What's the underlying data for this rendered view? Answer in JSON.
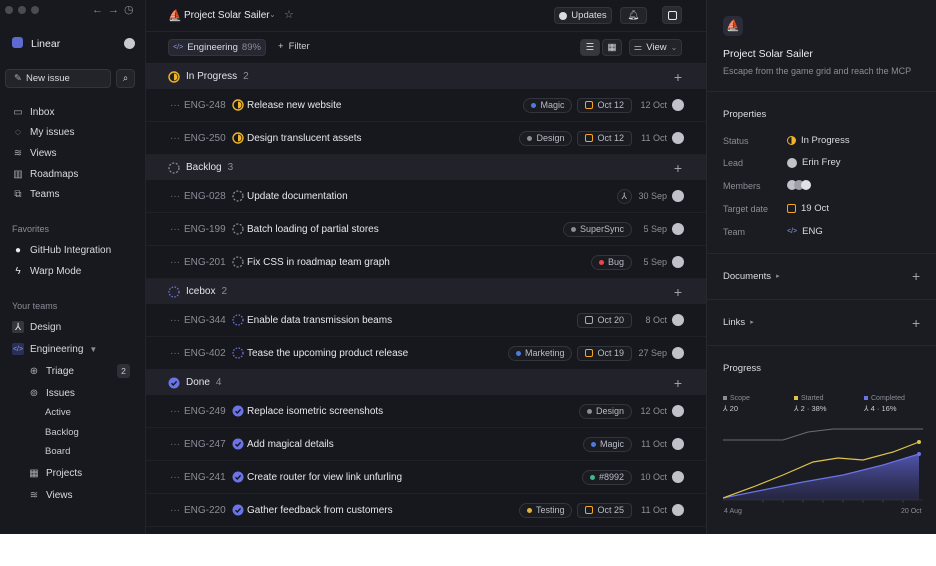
{
  "sidebar": {
    "workspace": "Linear",
    "new_issue": "New issue",
    "nav": [
      "Inbox",
      "My issues",
      "Views",
      "Roadmaps",
      "Teams"
    ],
    "favorites_label": "Favorites",
    "favorites": [
      "GitHub Integration",
      "Warp Mode"
    ],
    "your_teams_label": "Your teams",
    "teams": {
      "design": "Design",
      "engineering": "Engineering"
    },
    "triage": "Triage",
    "triage_count": "2",
    "issues": "Issues",
    "issue_views": [
      "Active",
      "Backlog",
      "Board"
    ],
    "projects": "Projects",
    "views": "Views"
  },
  "header": {
    "project": "Project Solar Sailer",
    "updates": "Updates",
    "team_filter": "Engineering",
    "team_pct": "89%",
    "filter": "Filter",
    "view": "View"
  },
  "groups": [
    {
      "name": "In Progress",
      "count": "2",
      "issues": [
        {
          "id": "ENG-248",
          "title": "Release new website",
          "label": "Magic",
          "label_color": "#4f7bdc",
          "due": "Oct 12",
          "date": "12 Oct"
        },
        {
          "id": "ENG-250",
          "title": "Design translucent assets",
          "label": "Design",
          "label_color": "#8a8d97",
          "due": "Oct 12",
          "date": "11 Oct"
        }
      ]
    },
    {
      "name": "Backlog",
      "count": "3",
      "issues": [
        {
          "id": "ENG-028",
          "title": "Update documentation",
          "label": "",
          "label_color": "",
          "due": "",
          "date": "30 Sep"
        },
        {
          "id": "ENG-199",
          "title": "Batch loading of partial stores",
          "label": "SuperSync",
          "label_color": "#8a8d97",
          "due": "",
          "date": "5 Sep"
        },
        {
          "id": "ENG-201",
          "title": "Fix CSS in roadmap team graph",
          "label": "Bug",
          "label_color": "#e5484d",
          "due": "",
          "date": "5 Sep"
        }
      ]
    },
    {
      "name": "Icebox",
      "count": "2",
      "issues": [
        {
          "id": "ENG-344",
          "title": "Enable data transmission beams",
          "label": "",
          "label_color": "",
          "due": "Oct 20",
          "date": "8 Oct"
        },
        {
          "id": "ENG-402",
          "title": "Tease the upcoming product release",
          "label": "Marketing",
          "label_color": "#4f7bdc",
          "due": "Oct 19",
          "date": "27 Sep"
        }
      ]
    },
    {
      "name": "Done",
      "count": "4",
      "issues": [
        {
          "id": "ENG-249",
          "title": "Replace isometric screenshots",
          "label": "Design",
          "label_color": "#8a8d97",
          "due": "",
          "date": "12 Oct"
        },
        {
          "id": "ENG-247",
          "title": "Add magical details",
          "label": "Magic",
          "label_color": "#4f7bdc",
          "due": "",
          "date": "11 Oct"
        },
        {
          "id": "ENG-241",
          "title": "Create router for view link unfurling",
          "label": "#8992",
          "label_color": "#3fb68b",
          "due": "",
          "date": "10 Oct"
        },
        {
          "id": "ENG-220",
          "title": "Gather feedback from customers",
          "label": "Testing",
          "label_color": "#e0b43a",
          "due": "Oct 25",
          "date": "11 Oct"
        }
      ]
    }
  ],
  "panel": {
    "title": "Project Solar Sailer",
    "desc": "Escape from the game grid and reach the MCP",
    "properties": "Properties",
    "status_label": "Status",
    "status": "In Progress",
    "lead_label": "Lead",
    "lead": "Erin Frey",
    "members_label": "Members",
    "target_label": "Target date",
    "target": "19 Oct",
    "team_label": "Team",
    "team": "ENG",
    "documents": "Documents",
    "links": "Links",
    "progress": "Progress",
    "scope_label": "Scope",
    "scope": "20",
    "started_label": "Started",
    "started": "2 · 38%",
    "completed_label": "Completed",
    "completed": "4 · 16%",
    "x_start": "4 Aug",
    "x_end": "20 Oct"
  },
  "colors": {
    "accent": "#5e6ad2",
    "in_progress": "#f0b429",
    "due": "#f5a623"
  }
}
